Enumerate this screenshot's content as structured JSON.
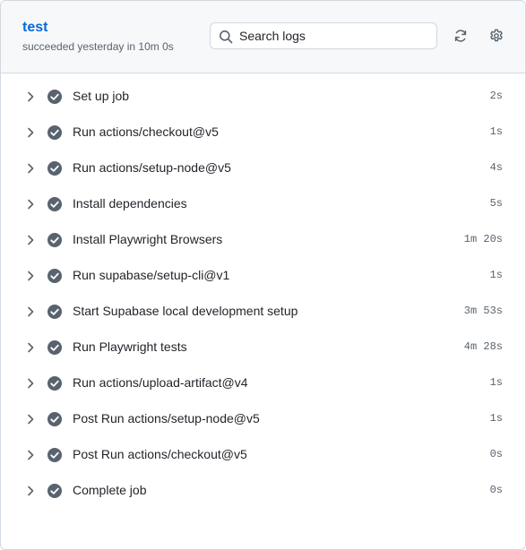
{
  "job": {
    "title": "test",
    "status": "succeeded yesterday in 10m 0s"
  },
  "search": {
    "placeholder": "Search logs",
    "icon": "search-icon"
  },
  "toolbar": {
    "refresh_icon": "sync-icon",
    "settings_icon": "gear-icon"
  },
  "colors": {
    "link": "#0969da",
    "check": "#59636e",
    "header_bg": "#f6f8fa",
    "border": "#d1d9e0"
  },
  "steps": [
    {
      "name": "Set up job",
      "duration": "2s",
      "status": "success"
    },
    {
      "name": "Run actions/checkout@v5",
      "duration": "1s",
      "status": "success"
    },
    {
      "name": "Run actions/setup-node@v5",
      "duration": "4s",
      "status": "success"
    },
    {
      "name": "Install dependencies",
      "duration": "5s",
      "status": "success"
    },
    {
      "name": "Install Playwright Browsers",
      "duration": "1m 20s",
      "status": "success"
    },
    {
      "name": "Run supabase/setup-cli@v1",
      "duration": "1s",
      "status": "success"
    },
    {
      "name": "Start Supabase local development setup",
      "duration": "3m 53s",
      "status": "success"
    },
    {
      "name": "Run Playwright tests",
      "duration": "4m 28s",
      "status": "success"
    },
    {
      "name": "Run actions/upload-artifact@v4",
      "duration": "1s",
      "status": "success"
    },
    {
      "name": "Post Run actions/setup-node@v5",
      "duration": "1s",
      "status": "success"
    },
    {
      "name": "Post Run actions/checkout@v5",
      "duration": "0s",
      "status": "success"
    },
    {
      "name": "Complete job",
      "duration": "0s",
      "status": "success"
    }
  ]
}
